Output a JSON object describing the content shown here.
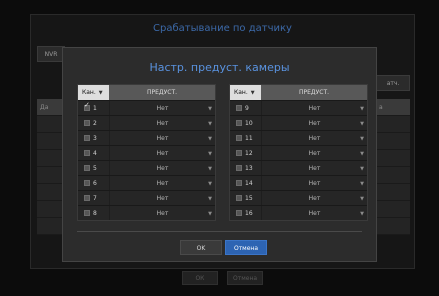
{
  "background": {
    "title": "Срабатывание по датчику",
    "tab_label": "NVR",
    "right_button_label": "атч.",
    "left_header": "Да",
    "right_header": "а",
    "bottom_buttons": [
      "ОК",
      "Отмена"
    ]
  },
  "dialog": {
    "title": "Настр. предуст. камеры",
    "columns": {
      "channel": "Кан.",
      "preset": "ПРЕДУСТ."
    },
    "left_rows": [
      {
        "channel": "1",
        "preset": "Нет",
        "checked": true
      },
      {
        "channel": "2",
        "preset": "Нет",
        "checked": false
      },
      {
        "channel": "3",
        "preset": "Нет",
        "checked": false
      },
      {
        "channel": "4",
        "preset": "Нет",
        "checked": false
      },
      {
        "channel": "5",
        "preset": "Нет",
        "checked": false
      },
      {
        "channel": "6",
        "preset": "Нет",
        "checked": false
      },
      {
        "channel": "7",
        "preset": "Нет",
        "checked": false
      },
      {
        "channel": "8",
        "preset": "Нет",
        "checked": false
      }
    ],
    "right_rows": [
      {
        "channel": "9",
        "preset": "Нет",
        "checked": false
      },
      {
        "channel": "10",
        "preset": "Нет",
        "checked": false
      },
      {
        "channel": "11",
        "preset": "Нет",
        "checked": false
      },
      {
        "channel": "12",
        "preset": "Нет",
        "checked": false
      },
      {
        "channel": "13",
        "preset": "Нет",
        "checked": false
      },
      {
        "channel": "14",
        "preset": "Нет",
        "checked": false
      },
      {
        "channel": "15",
        "preset": "Нет",
        "checked": false
      },
      {
        "channel": "16",
        "preset": "Нет",
        "checked": false
      }
    ],
    "ok_label": "OK",
    "cancel_label": "Отмена"
  }
}
